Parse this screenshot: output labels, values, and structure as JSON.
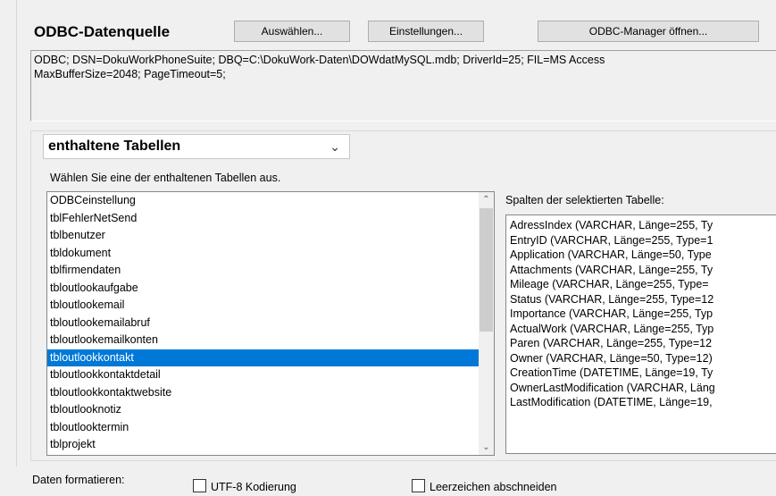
{
  "odbc": {
    "title": "ODBC-Datenquelle",
    "btn_select": "Auswählen...",
    "btn_settings": "Einstellungen...",
    "btn_manager": "ODBC-Manager öffnen...",
    "connection_string": "ODBC; DSN=DokuWorkPhoneSuite; DBQ=C:\\DokuWork-Daten\\DOWdatMySQL.mdb; DriverId=25; FIL=MS Access\nMaxBufferSize=2048; PageTimeout=5;"
  },
  "tables": {
    "dropdown_value": "enthaltene Tabellen",
    "hint": "Wählen Sie eine der enthaltenen Tabellen aus.",
    "items": [
      "ODBCeinstellung",
      "tblFehlerNetSend",
      "tblbenutzer",
      "tbldokument",
      "tblfirmendaten",
      "tbloutlookaufgabe",
      "tbloutlookemail",
      "tbloutlookemailabruf",
      "tbloutlookemailkonten",
      "tbloutlookkontakt",
      "tbloutlookkontaktdetail",
      "tbloutlookkontaktwebsite",
      "tbloutlooknotiz",
      "tbloutlooktermin",
      "tblprojekt"
    ],
    "selected_index": 9,
    "columns_label": "Spalten der selektierten Tabelle:",
    "columns": [
      "AdressIndex  (VARCHAR, Länge=255, Ty",
      "EntryID  (VARCHAR, Länge=255, Type=1",
      "Application  (VARCHAR, Länge=50, Type",
      "Attachments  (VARCHAR, Länge=255, Ty",
      "Mileage  (VARCHAR, Länge=255, Type=",
      "Status  (VARCHAR, Länge=255, Type=12",
      "Importance  (VARCHAR, Länge=255, Typ",
      "ActualWork  (VARCHAR, Länge=255, Typ",
      "Paren  (VARCHAR, Länge=255, Type=12",
      "Owner  (VARCHAR, Länge=50, Type=12)",
      "CreationTime  (DATETIME, Länge=19, Ty",
      "OwnerLastModification  (VARCHAR, Läng",
      "LastModification  (DATETIME, Länge=19,"
    ]
  },
  "format": {
    "label": "Daten formatieren:",
    "utf8": "UTF-8 Kodierung",
    "utf8_checked": false,
    "trim": "Leerzeichen abschneiden",
    "trim_checked": false
  },
  "colors": {
    "selection": "#0078d7",
    "window": "#f0f0f0"
  },
  "icons": {
    "dropdown": "chevron-down-icon",
    "scroll_up": "arrow-up-icon",
    "scroll_down": "arrow-down-icon"
  }
}
